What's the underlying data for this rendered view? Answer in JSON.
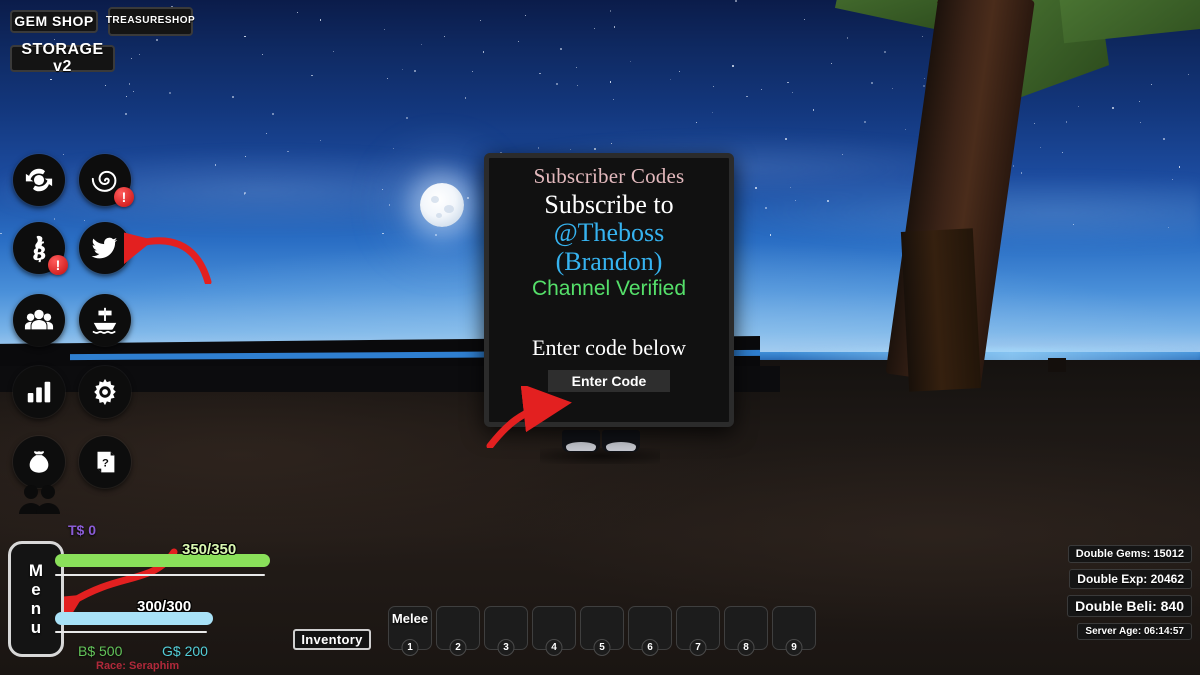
{
  "shop_buttons": [
    {
      "id": "gem-shop",
      "label": "GEM SHOP"
    },
    {
      "id": "treasure-shop",
      "label": "TREASURE\nSHOP"
    },
    {
      "id": "storage-v2",
      "label": "STORAGE v2"
    }
  ],
  "icon_rail": [
    {
      "name": "rebirth-icon",
      "badge": null
    },
    {
      "name": "spiral-fruit-icon",
      "badge": "!"
    },
    {
      "name": "beli-codes-icon",
      "badge": "!"
    },
    {
      "name": "twitter-icon",
      "badge": null
    },
    {
      "name": "crew-icon",
      "badge": null
    },
    {
      "name": "boat-icon",
      "badge": null
    },
    {
      "name": "stats-icon",
      "badge": null
    },
    {
      "name": "settings-icon",
      "badge": null
    },
    {
      "name": "moneybag-icon",
      "badge": null
    },
    {
      "name": "quest-scroll-icon",
      "badge": null
    }
  ],
  "codes_panel": {
    "title": "Subscriber Codes",
    "subscribe_to": "Subscribe to",
    "handle_line1": "@Theboss",
    "handle_line2": "(Brandon)",
    "verified": "Channel Verified",
    "enter_code_below": "Enter code below",
    "input_placeholder": "Enter Code",
    "input_value": "",
    "title_color": "#e3b9bd",
    "handle_color": "#36b3f0",
    "verified_color": "#55e06a"
  },
  "hud": {
    "menu_label": "Menu",
    "menu_letters": [
      "M",
      "e",
      "n",
      "u"
    ],
    "treasure_currency": "T$ 0",
    "treasure_currency_color": "#8a5cd6",
    "health": {
      "text": "350/350",
      "current": 350,
      "max": 350,
      "color": "#8ae05a"
    },
    "energy": {
      "text": "300/300",
      "current": 300,
      "max": 300,
      "color": "#a9e2f7"
    },
    "beli": {
      "text": "B$ 500",
      "color": "#63c45a"
    },
    "gems": {
      "text": "G$ 200",
      "color": "#53cdd8"
    },
    "race": {
      "text": "Race: Seraphim",
      "color": "#b0293a"
    }
  },
  "hotbar": {
    "inventory_label": "Inventory",
    "slots": [
      {
        "num": "1",
        "label": "Melee"
      },
      {
        "num": "2",
        "label": ""
      },
      {
        "num": "3",
        "label": ""
      },
      {
        "num": "4",
        "label": ""
      },
      {
        "num": "5",
        "label": ""
      },
      {
        "num": "6",
        "label": ""
      },
      {
        "num": "7",
        "label": ""
      },
      {
        "num": "8",
        "label": ""
      },
      {
        "num": "9",
        "label": ""
      }
    ]
  },
  "server_stats": [
    {
      "label": "Double Gems: 15012"
    },
    {
      "label": "Double Exp: 20462"
    },
    {
      "label": "Double Beli: 840"
    },
    {
      "label": "Server Age: 06:14:57"
    }
  ],
  "annotations": {
    "arrow_color": "#e32020",
    "arrow_to_twitter": "points left at the twitter icon",
    "arrow_to_enter_code": "points right at the Enter Code field",
    "arrow_to_menu": "points left at the Menu button"
  }
}
